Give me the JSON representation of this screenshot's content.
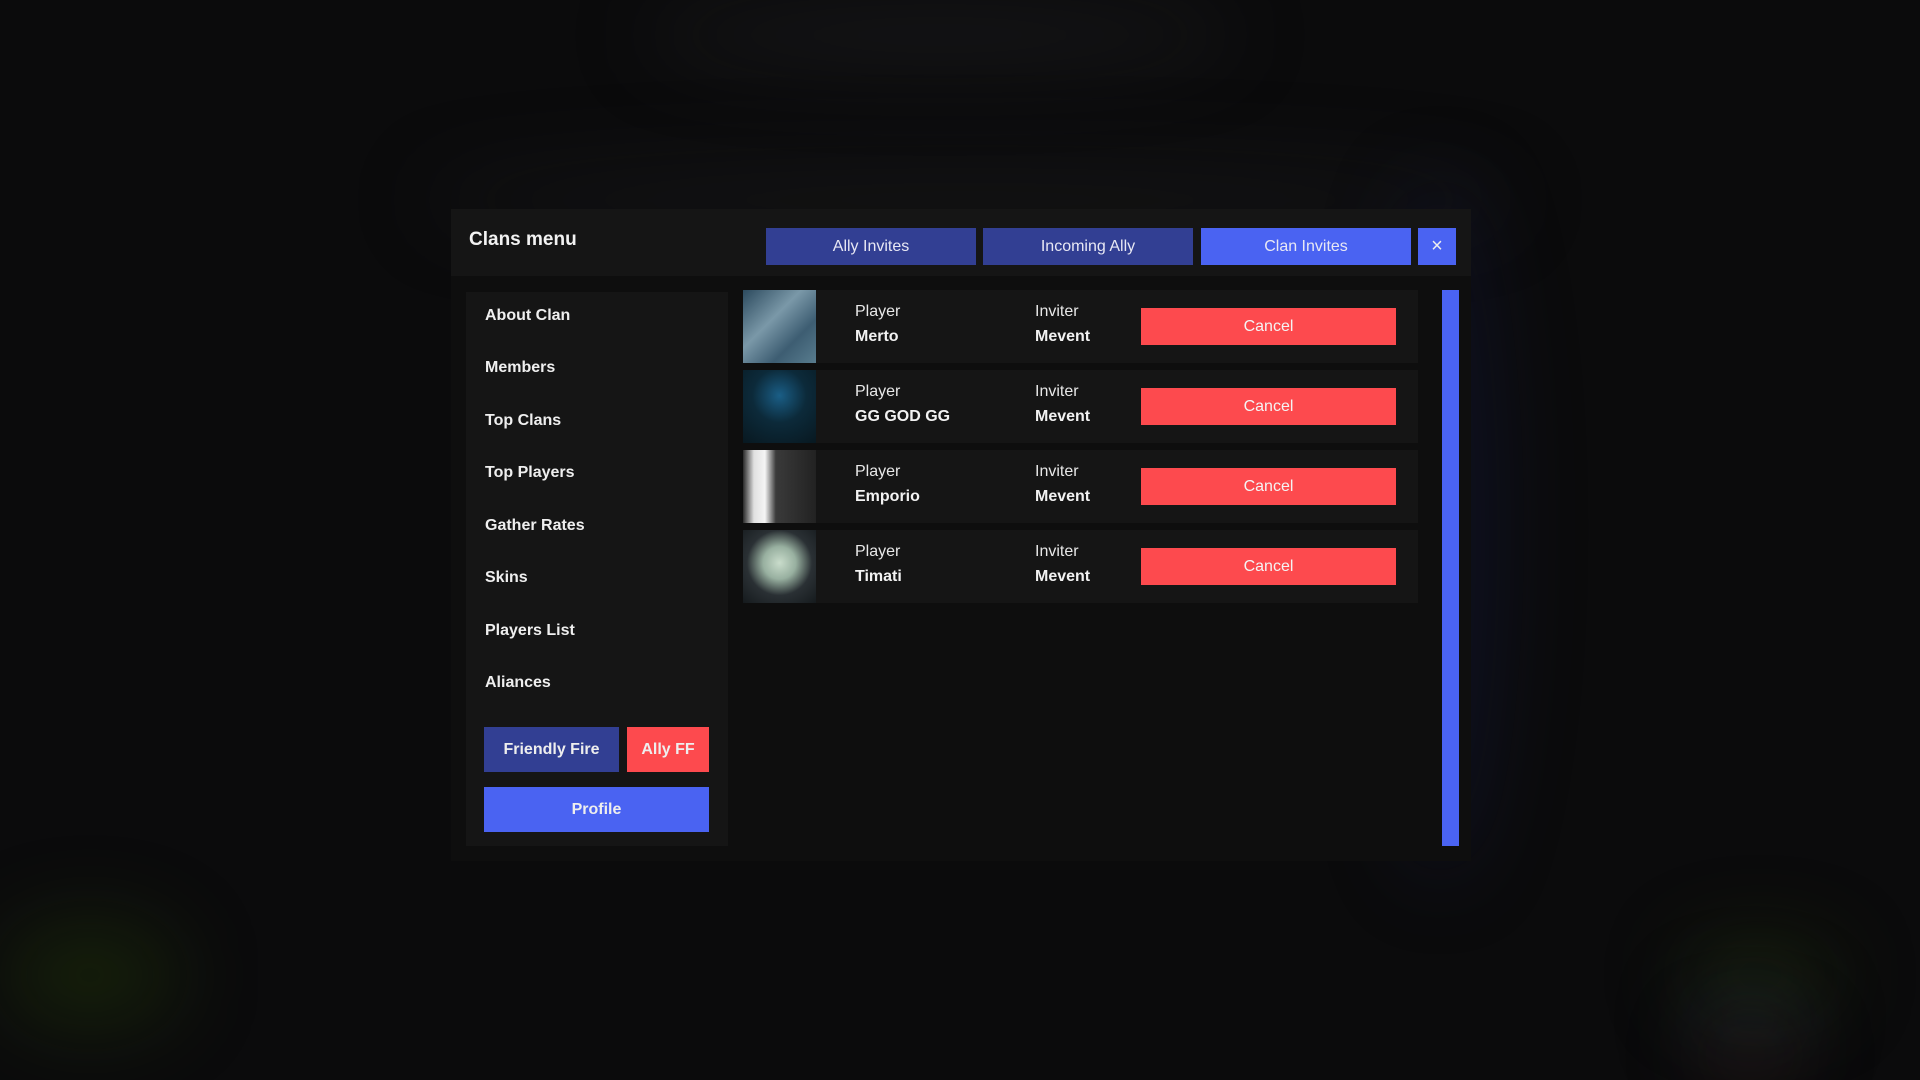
{
  "modal": {
    "title": "Clans menu",
    "tabs": [
      {
        "label": "Ally Invites",
        "active": false
      },
      {
        "label": "Incoming Ally",
        "active": false
      },
      {
        "label": "Clan Invites",
        "active": true
      }
    ],
    "close_icon": "×"
  },
  "sidebar": {
    "items": [
      {
        "label": "About Clan"
      },
      {
        "label": "Members"
      },
      {
        "label": "Top Clans"
      },
      {
        "label": "Top Players"
      },
      {
        "label": "Gather Rates"
      },
      {
        "label": "Skins"
      },
      {
        "label": "Players List"
      },
      {
        "label": "Aliances"
      }
    ],
    "friendly_fire_label": "Friendly Fire",
    "ally_ff_label": "Ally FF",
    "profile_label": "Profile"
  },
  "invites": {
    "player_label": "Player",
    "inviter_label": "Inviter",
    "cancel_label": "Cancel",
    "rows": [
      {
        "player": "Merto",
        "inviter": "Mevent",
        "avatar": "avatar-icon"
      },
      {
        "player": "GG GOD GG",
        "inviter": "Mevent",
        "avatar": "avatar-icon"
      },
      {
        "player": "Emporio",
        "inviter": "Mevent",
        "avatar": "avatar-icon"
      },
      {
        "player": "Timati",
        "inviter": "Mevent",
        "avatar": "avatar-icon"
      }
    ]
  },
  "colors": {
    "accent": "#4a63f2",
    "accent_dim": "#323f93",
    "danger": "#fd4a4e",
    "panel": "#151515",
    "modal_bg": "#0e0e0e"
  }
}
